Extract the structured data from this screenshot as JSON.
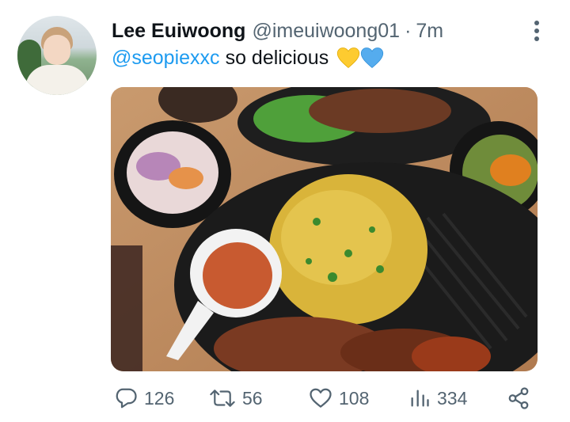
{
  "tweet": {
    "author_name": "Lee Euiwoong",
    "author_handle": "@imeuiwoong01",
    "separator": "·",
    "time": "7m",
    "mention": "@seopiexxc",
    "text": "so delicious",
    "emoji_hearts": [
      "yellow-heart",
      "blue-heart"
    ],
    "colors": {
      "accent": "#1d9bf0",
      "muted": "#536471",
      "text": "#0f1419"
    }
  },
  "actions": {
    "reply_count": "126",
    "retweet_count": "56",
    "like_count": "108",
    "views_count": "334"
  },
  "icons": [
    "more-vertical-icon",
    "reply-icon",
    "retweet-icon",
    "like-icon",
    "views-icon",
    "share-icon"
  ]
}
